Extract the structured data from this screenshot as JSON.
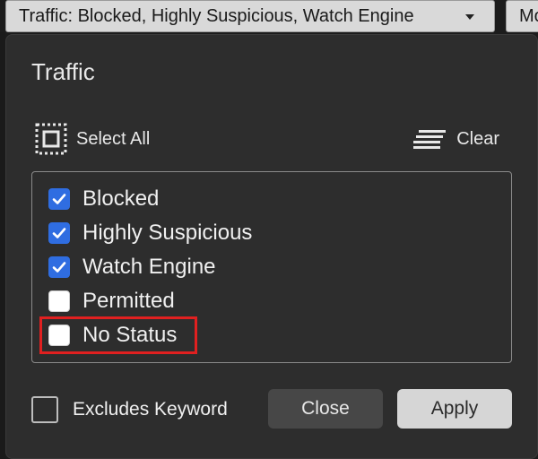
{
  "top_bar": {
    "traffic_filter_label": "Traffic: Blocked, Highly Suspicious, Watch Engine",
    "next_filter_label": "Mo"
  },
  "panel": {
    "title": "Traffic",
    "select_all_label": "Select All",
    "clear_label": "Clear",
    "options": [
      {
        "label": "Blocked",
        "checked": true
      },
      {
        "label": "Highly Suspicious",
        "checked": true
      },
      {
        "label": "Watch Engine",
        "checked": true
      },
      {
        "label": "Permitted",
        "checked": false
      },
      {
        "label": "No Status",
        "checked": false
      }
    ],
    "highlighted_option": "No Status",
    "excludes_keyword_label": "Excludes Keyword",
    "excludes_keyword_checked": false,
    "close_label": "Close",
    "apply_label": "Apply"
  },
  "colors": {
    "panel_bg": "#2d2d2d",
    "checkbox_checked": "#2f6de1",
    "highlight_border": "#e02020",
    "apply_bg": "#d6d6d6",
    "close_bg": "#474747"
  }
}
